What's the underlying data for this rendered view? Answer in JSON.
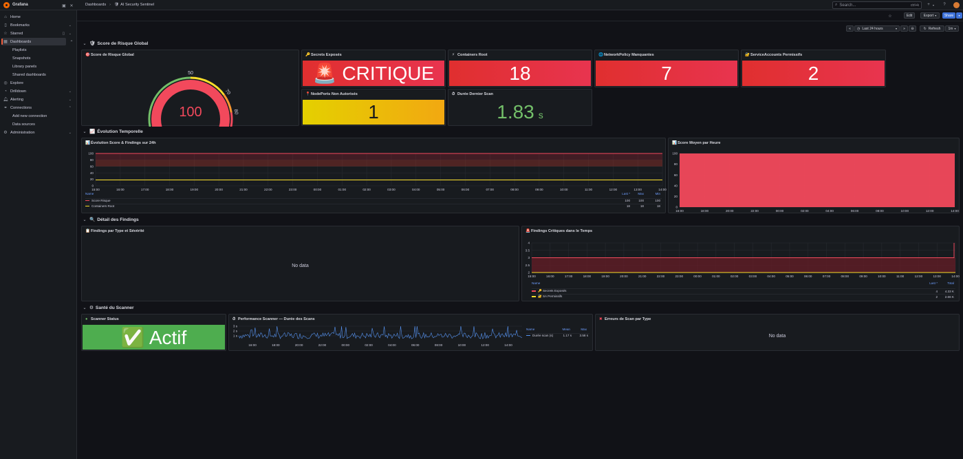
{
  "app": {
    "name": "Grafana"
  },
  "topbar": {
    "breadcrumb_root": "Dashboards",
    "breadcrumb_current": "AI Security Sentinel",
    "search_placeholder": "Search...",
    "search_shortcut": "ctrl+k"
  },
  "sidebar": {
    "items": [
      {
        "label": "Home",
        "icon": "home-icon"
      },
      {
        "label": "Bookmarks",
        "icon": "bookmark-icon"
      },
      {
        "label": "Starred",
        "icon": "star-icon"
      },
      {
        "label": "Dashboards",
        "icon": "dashboards-icon"
      },
      {
        "label": "Explore",
        "icon": "explore-icon"
      },
      {
        "label": "Drilldown",
        "icon": "drilldown-icon"
      },
      {
        "label": "Alerting",
        "icon": "bell-icon"
      },
      {
        "label": "Connections",
        "icon": "connections-icon"
      },
      {
        "label": "Administration",
        "icon": "gear-icon"
      }
    ],
    "dashboards_sub": [
      "Playlists",
      "Snapshots",
      "Library panels",
      "Shared dashboards"
    ],
    "connections_sub": [
      "Add new connection",
      "Data sources"
    ]
  },
  "toolbar": {
    "edit": "Edit",
    "export": "Export",
    "share": "Share",
    "time_range": "Last 24 hours",
    "refresh": "Refresh",
    "refresh_interval": "1m"
  },
  "rows": {
    "r1": "Score de Risque Global",
    "r2": "Évolution Temporelle",
    "r3": "Détail des Findings",
    "r4": "Santé du Scanner"
  },
  "panels": {
    "gauge": {
      "title": "Score de Risque Global",
      "value": "100",
      "ticks": [
        "0",
        "50",
        "70",
        "80",
        "100"
      ],
      "value_num": 100,
      "max": 100
    },
    "secrets": {
      "title": "Secrets Exposés",
      "value": "🚨 CRITIQUE"
    },
    "containers": {
      "title": "Containers Root",
      "value": "18"
    },
    "netpol": {
      "title": "NetworkPolicy Manquantes",
      "value": "7"
    },
    "svcacc": {
      "title": "ServiceAccounts Permissifs",
      "value": "2"
    },
    "nodeports": {
      "title": "NodePorts Non Autorisés",
      "value": "1"
    },
    "scan_duration": {
      "title": "Durée Dernier Scan",
      "value": "1.83",
      "unit": "s"
    },
    "evolution": {
      "title": "Évolution Score & Findings sur 24h"
    },
    "score_hour": {
      "title": "Score Moyen par Heure"
    },
    "findings_type": {
      "title": "Findings par Type et Sévérité",
      "nodata": "No data"
    },
    "findings_crit": {
      "title": "Findings Critiques dans le Temps"
    },
    "scanner_status": {
      "title": "Scanner Status",
      "value": "✅ Actif"
    },
    "scanner_perf": {
      "title": "Performance Scanner — Durée des Scans"
    },
    "scan_errors": {
      "title": "Erreurs de Scan par Type",
      "nodata": "No data"
    }
  },
  "legend_evolution": {
    "headers": [
      "Name",
      "Last *",
      "Max",
      "Min"
    ],
    "rows": [
      {
        "name": "Score Risque",
        "color": "#f2495c",
        "last": "100",
        "max": "100",
        "min": "100"
      },
      {
        "name": "Containers Root",
        "color": "#fade2a",
        "last": "18",
        "max": "18",
        "min": "18"
      }
    ]
  },
  "legend_crit": {
    "headers": [
      "Name",
      "Last *",
      "Total"
    ],
    "rows": [
      {
        "name": "🔑 Secrets Exposés",
        "color": "#f2495c",
        "last": "4",
        "total": "4.33 K"
      },
      {
        "name": "🔐 SA Permissifs",
        "color": "#fade2a",
        "last": "2",
        "total": "2.66 K"
      }
    ]
  },
  "legend_perf": {
    "headers": [
      "Name",
      "Mean",
      "Max"
    ],
    "rows": [
      {
        "name": "Durée scan (s)",
        "color": "#5794f2",
        "mean": "1.17 s",
        "max": "3.58 s"
      }
    ]
  },
  "chart_data": [
    {
      "type": "line",
      "title": "Évolution Score & Findings sur 24h",
      "x": [
        "15:00",
        "16:00",
        "17:00",
        "18:00",
        "19:00",
        "20:00",
        "21:00",
        "22:00",
        "23:00",
        "00:00",
        "01:00",
        "02:00",
        "03:00",
        "04:00",
        "05:00",
        "06:00",
        "07:00",
        "08:00",
        "09:00",
        "10:00",
        "11:00",
        "12:00",
        "13:00",
        "14:00"
      ],
      "ylim": [
        0,
        100
      ],
      "yticks": [
        "0",
        "20",
        "40",
        "60",
        "80",
        "100"
      ],
      "series": [
        {
          "name": "Score Risque",
          "color": "#f2495c",
          "value": 100
        },
        {
          "name": "Containers Root",
          "color": "#fade2a",
          "value": 18
        }
      ],
      "thresholds": [
        {
          "from": 60,
          "to": 80,
          "color": "#b8372a"
        },
        {
          "from": 80,
          "to": 100,
          "color": "#8f1f2f"
        }
      ]
    },
    {
      "type": "area",
      "title": "Score Moyen par Heure",
      "x": [
        "16:00",
        "18:00",
        "20:00",
        "22:00",
        "00:00",
        "02:00",
        "04:00",
        "06:00",
        "08:00",
        "10:00",
        "12:00",
        "14:00"
      ],
      "ylim": [
        0,
        100
      ],
      "yticks": [
        "0",
        "20",
        "40",
        "60",
        "80",
        "100"
      ],
      "series": [
        {
          "name": "Score Moyen",
          "color": "#f2495c",
          "value": 100
        }
      ]
    },
    {
      "type": "line",
      "title": "Findings Critiques dans le Temps",
      "x": [
        "15:00",
        "16:00",
        "17:00",
        "18:00",
        "19:00",
        "20:00",
        "21:00",
        "22:00",
        "23:00",
        "00:00",
        "01:00",
        "02:00",
        "03:00",
        "04:00",
        "05:00",
        "06:00",
        "07:00",
        "08:00",
        "09:00",
        "10:00",
        "11:00",
        "12:00",
        "13:00",
        "14:00"
      ],
      "ylim": [
        2,
        4
      ],
      "yticks": [
        "2",
        "2.5",
        "3",
        "3.5",
        "4"
      ],
      "series": [
        {
          "name": "🔑 Secrets Exposés",
          "color": "#f2495c",
          "value": 3,
          "last": 4
        },
        {
          "name": "🔐 SA Permissifs",
          "color": "#fade2a",
          "value": 2,
          "last": 2
        }
      ]
    },
    {
      "type": "line",
      "title": "Performance Scanner — Durée des Scans",
      "x": [
        "16:00",
        "18:00",
        "20:00",
        "22:00",
        "00:00",
        "02:00",
        "04:00",
        "06:00",
        "08:00",
        "10:00",
        "12:00",
        "14:00"
      ],
      "ylim": [
        0,
        3
      ],
      "yticks": [
        "1 s",
        "2 s",
        "3 s"
      ],
      "series": [
        {
          "name": "Durée scan (s)",
          "color": "#5794f2",
          "mean": 1.17,
          "max": 3.58
        }
      ]
    }
  ]
}
